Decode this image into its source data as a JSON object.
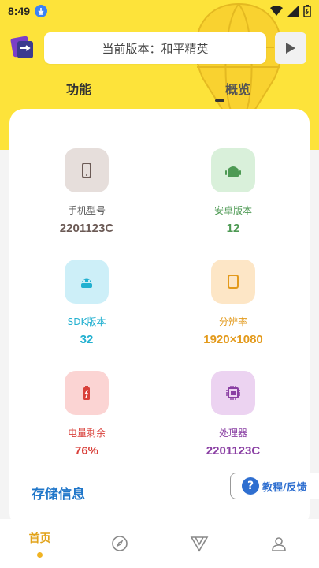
{
  "status_bar": {
    "time": "8:49"
  },
  "header": {
    "version_text": "当前版本：和平精英",
    "tabs": [
      {
        "label": "功能",
        "active": true
      },
      {
        "label": "概览",
        "active": false
      }
    ]
  },
  "device_info": [
    {
      "label": "手机型号",
      "value": "2201123C",
      "icon": "phone-icon",
      "color": "#6b5a55",
      "bg": "#e6dedb"
    },
    {
      "label": "安卓版本",
      "value": "12",
      "icon": "android-icon",
      "color": "#4e9a54",
      "bg": "#d9f0da"
    },
    {
      "label": "SDK版本",
      "value": "32",
      "icon": "android-head-icon",
      "color": "#22b0d0",
      "bg": "#cdeff8"
    },
    {
      "label": "分辨率",
      "value": "1920×1080",
      "icon": "screen-icon",
      "color": "#e39a1c",
      "bg": "#fde6c6"
    },
    {
      "label": "电量剩余",
      "value": "76%",
      "icon": "battery-icon",
      "color": "#d9413b",
      "bg": "#fbd4d3"
    },
    {
      "label": "处理器",
      "value": "2201123C",
      "icon": "cpu-icon",
      "color": "#8a3fa3",
      "bg": "#ecd3f1"
    }
  ],
  "storage": {
    "title": "存储信息"
  },
  "feedback": {
    "label": "教程/反馈"
  },
  "bottom_nav": [
    {
      "label": "首页",
      "icon": "home",
      "active": true
    },
    {
      "icon": "compass-icon"
    },
    {
      "icon": "v-icon"
    },
    {
      "icon": "profile-icon"
    }
  ],
  "colors": {
    "accent_yellow": "#fde33a",
    "nav_active": "#e2a31a",
    "link_blue": "#1f76c9"
  }
}
